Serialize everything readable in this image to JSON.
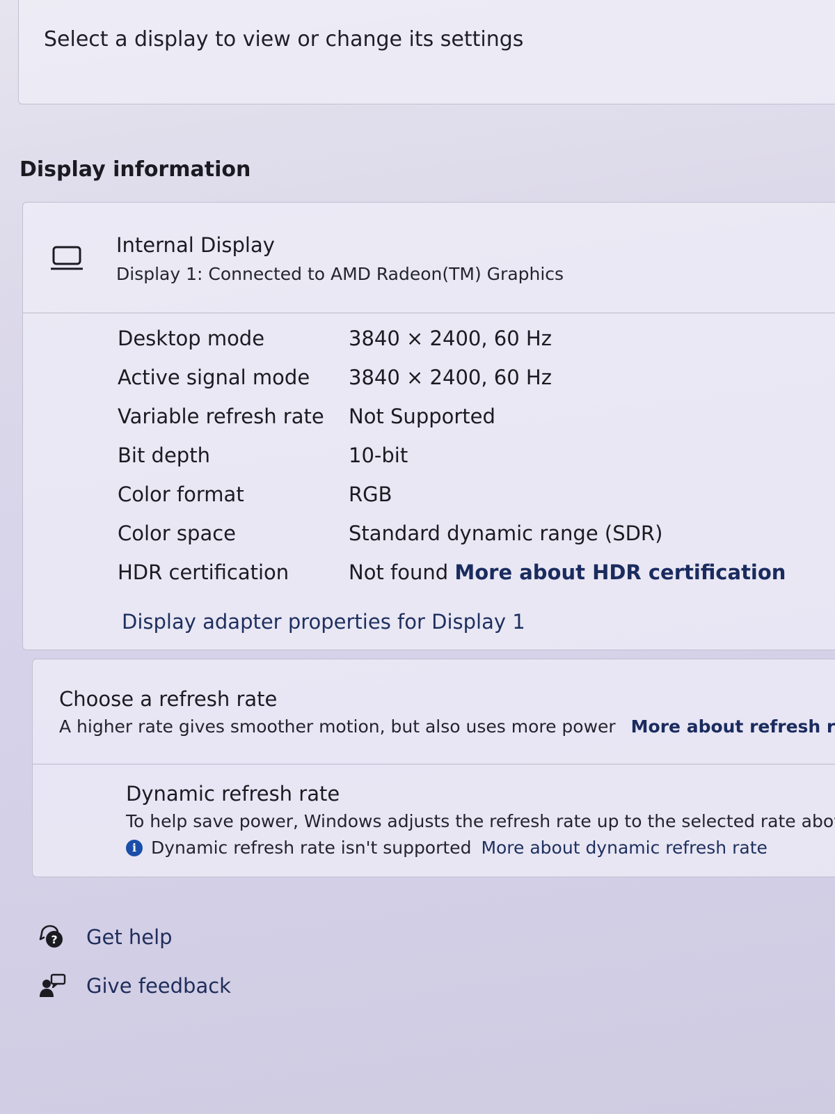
{
  "top": {
    "select_display_text": "Select a display to view or change its settings"
  },
  "display_information": {
    "section_title": "Display information",
    "display_name": "Internal Display",
    "display_subtitle": "Display 1: Connected to AMD Radeon(TM) Graphics",
    "rows": [
      {
        "label": "Desktop mode",
        "value": "3840 × 2400, 60 Hz"
      },
      {
        "label": "Active signal mode",
        "value": "3840 × 2400, 60 Hz"
      },
      {
        "label": "Variable refresh rate",
        "value": "Not Supported"
      },
      {
        "label": "Bit depth",
        "value": "10-bit"
      },
      {
        "label": "Color format",
        "value": "RGB"
      },
      {
        "label": "Color space",
        "value": "Standard dynamic range (SDR)"
      },
      {
        "label": "HDR certification",
        "value": "Not found",
        "link": "More about HDR certification"
      }
    ],
    "adapter_link": "Display adapter properties for Display 1"
  },
  "refresh": {
    "title": "Choose a refresh rate",
    "description": "A higher rate gives smoother motion, but also uses more power",
    "more_link": "More about refresh rate",
    "dynamic_title": "Dynamic refresh rate",
    "dynamic_description": "To help save power, Windows adjusts the refresh rate up to the selected rate above",
    "dynamic_note": "Dynamic refresh rate isn't supported",
    "dynamic_link": "More about dynamic refresh rate"
  },
  "footer": {
    "get_help": "Get help",
    "give_feedback": "Give feedback"
  },
  "icons": {
    "display": "laptop-icon",
    "info": "info-icon",
    "help": "help-icon",
    "feedback": "feedback-icon"
  },
  "colors": {
    "link": "#1a2b5e",
    "info_accent": "#1b4ea8"
  }
}
